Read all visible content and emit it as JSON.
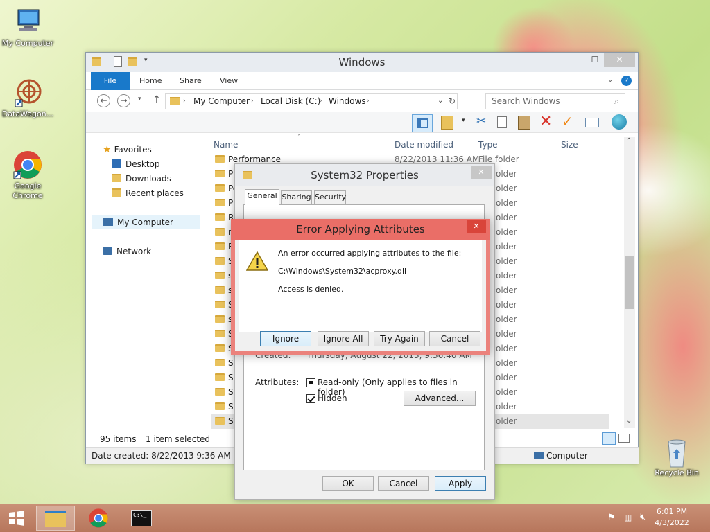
{
  "desktop": {
    "icons": [
      {
        "label": "My Computer"
      },
      {
        "label": "DataWagon..."
      },
      {
        "label": "Google Chrome"
      },
      {
        "label": "Recycle Bin"
      }
    ]
  },
  "explorer": {
    "title": "Windows",
    "ribbon_tabs": [
      "File",
      "Home",
      "Share",
      "View"
    ],
    "address": {
      "crumbs": [
        "My Computer",
        "Local Disk (C:)",
        "Windows"
      ]
    },
    "search_placeholder": "Search Windows",
    "nav": {
      "favorites": "Favorites",
      "desktop": "Desktop",
      "downloads": "Downloads",
      "recent": "Recent places",
      "my_computer": "My Computer",
      "network": "Network"
    },
    "columns": {
      "name": "Name",
      "date": "Date modified",
      "type": "Type",
      "size": "Size"
    },
    "first_row": {
      "name": "Performance",
      "date": "8/22/2013 11:36 AM",
      "type": "File folder"
    },
    "partial_names": [
      "PL",
      "Po",
      "Pr",
      "Re",
      "re",
      "Re",
      "Sc",
      "sc",
      "se",
      "Se",
      "se",
      "Se",
      "Se",
      "SK",
      "Sc",
      "Sp",
      "Sy",
      "Sy"
    ],
    "partial_type": "older",
    "status": {
      "items": "95 items",
      "selected": "1 item selected"
    },
    "details": {
      "created": "Date created: 8/22/2013 9:36 AM",
      "location": "Computer"
    }
  },
  "properties": {
    "title": "System32 Properties",
    "tabs": [
      "General",
      "Sharing",
      "Security"
    ],
    "created_label": "Created:",
    "created_value": "Thursday, August 22, 2013, 9:36:40 AM",
    "attributes_label": "Attributes:",
    "readonly_label": "Read-only (Only applies to files in folder)",
    "hidden_label": "Hidden",
    "advanced_label": "Advanced...",
    "ok_label": "OK",
    "cancel_label": "Cancel",
    "apply_label": "Apply"
  },
  "error_dialog": {
    "title": "Error Applying Attributes",
    "line1": "An error occurred applying attributes to the file:",
    "path": "C:\\Windows\\System32\\acproxy.dll",
    "line3": "Access is denied.",
    "buttons": {
      "ignore": "Ignore",
      "ignore_all": "Ignore All",
      "try_again": "Try Again",
      "cancel": "Cancel"
    }
  },
  "taskbar": {
    "time": "6:01 PM",
    "date": "4/3/2022"
  }
}
